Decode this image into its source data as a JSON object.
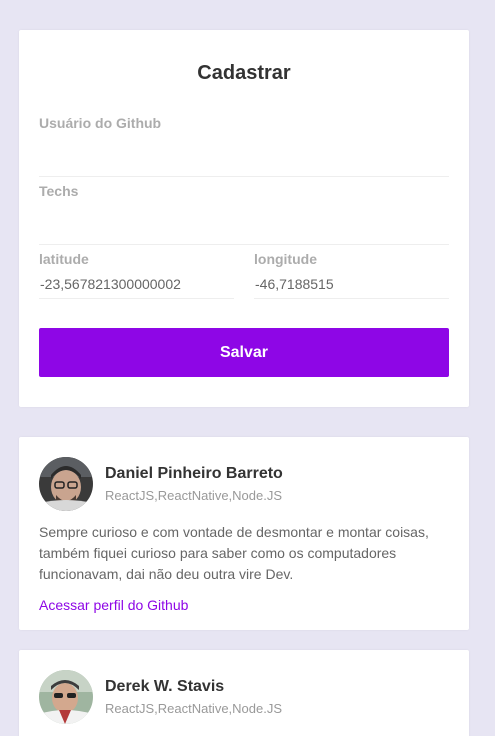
{
  "form": {
    "title": "Cadastrar",
    "github_username": {
      "label": "Usuário do Github",
      "value": ""
    },
    "techs": {
      "label": "Techs",
      "value": ""
    },
    "latitude": {
      "label": "latitude",
      "value": "-23,567821300000002"
    },
    "longitude": {
      "label": "longitude",
      "value": "-46,7188515"
    },
    "submit_label": "Salvar"
  },
  "devs": [
    {
      "name": "Daniel Pinheiro Barreto",
      "techs": "ReactJS,ReactNative,Node.JS",
      "bio": "Sempre curioso e com vontade de desmontar e montar coisas, também fiquei curioso para saber como os computadores funcionavam, dai não deu outra vire Dev.",
      "link_label": "Acessar perfil do Github"
    },
    {
      "name": "Derek W. Stavis",
      "techs": "ReactJS,ReactNative,Node.JS"
    }
  ],
  "colors": {
    "background": "#e7e5f3",
    "accent": "#8e06e6",
    "card": "#ffffff"
  }
}
